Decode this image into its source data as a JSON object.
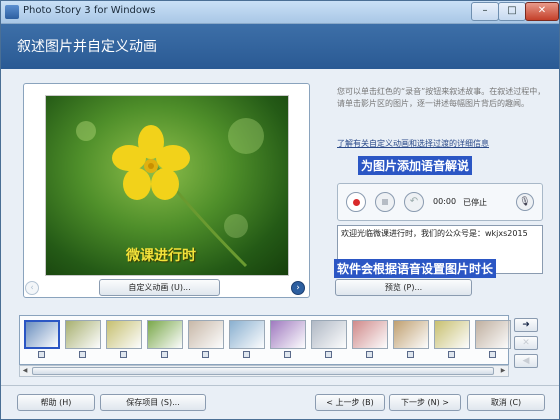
{
  "window": {
    "title": "Photo Story 3 for Windows",
    "minimize": "–",
    "maximize": "□",
    "close": "✕"
  },
  "banner": {
    "title": "叙述图片并自定义动画"
  },
  "preview": {
    "caption": "微课进行时",
    "custom_animation_label": "自定义动画 (U)...",
    "prev_icon": "chevron-left-icon",
    "next_icon": "chevron-right-icon"
  },
  "instructions": {
    "description": "您可以单击红色的“录音”按钮来叙述故事。在叙述过程中，请单击影片区的图片，逐一讲述每幅图片背后的趣闻。",
    "link": "了解有关自定义动画和选择过渡的详细信息"
  },
  "annotations": {
    "note1": "为图片添加语音解说",
    "note2": "软件会根据语音设置图片时长"
  },
  "recorder": {
    "time": "00:00",
    "status": "已停止",
    "mic_icon": "microphone-icon"
  },
  "narration_text": "欢迎光临微课进行时，我们的公众号是：wkjxs2015",
  "preview_button": "预览 (P)...",
  "filmstrip": {
    "count": 12,
    "selected_index": 0,
    "colors": [
      "#6b8fbf",
      "#a8b070",
      "#c6c070",
      "#7aa84a",
      "#c8b8a8",
      "#8ab0d0",
      "#a07ac0",
      "#b0b8c4",
      "#d08a8a",
      "#c0a070",
      "#c8c070",
      "#c0b0a0"
    ]
  },
  "side_buttons": {
    "move_right": "➜",
    "delete": "✕",
    "move_left": "◀"
  },
  "bottom": {
    "help": "帮助 (H)",
    "save": "保存项目 (S)...",
    "back": "< 上一步 (B)",
    "next": "下一步 (N) >",
    "cancel": "取消 (C)"
  }
}
